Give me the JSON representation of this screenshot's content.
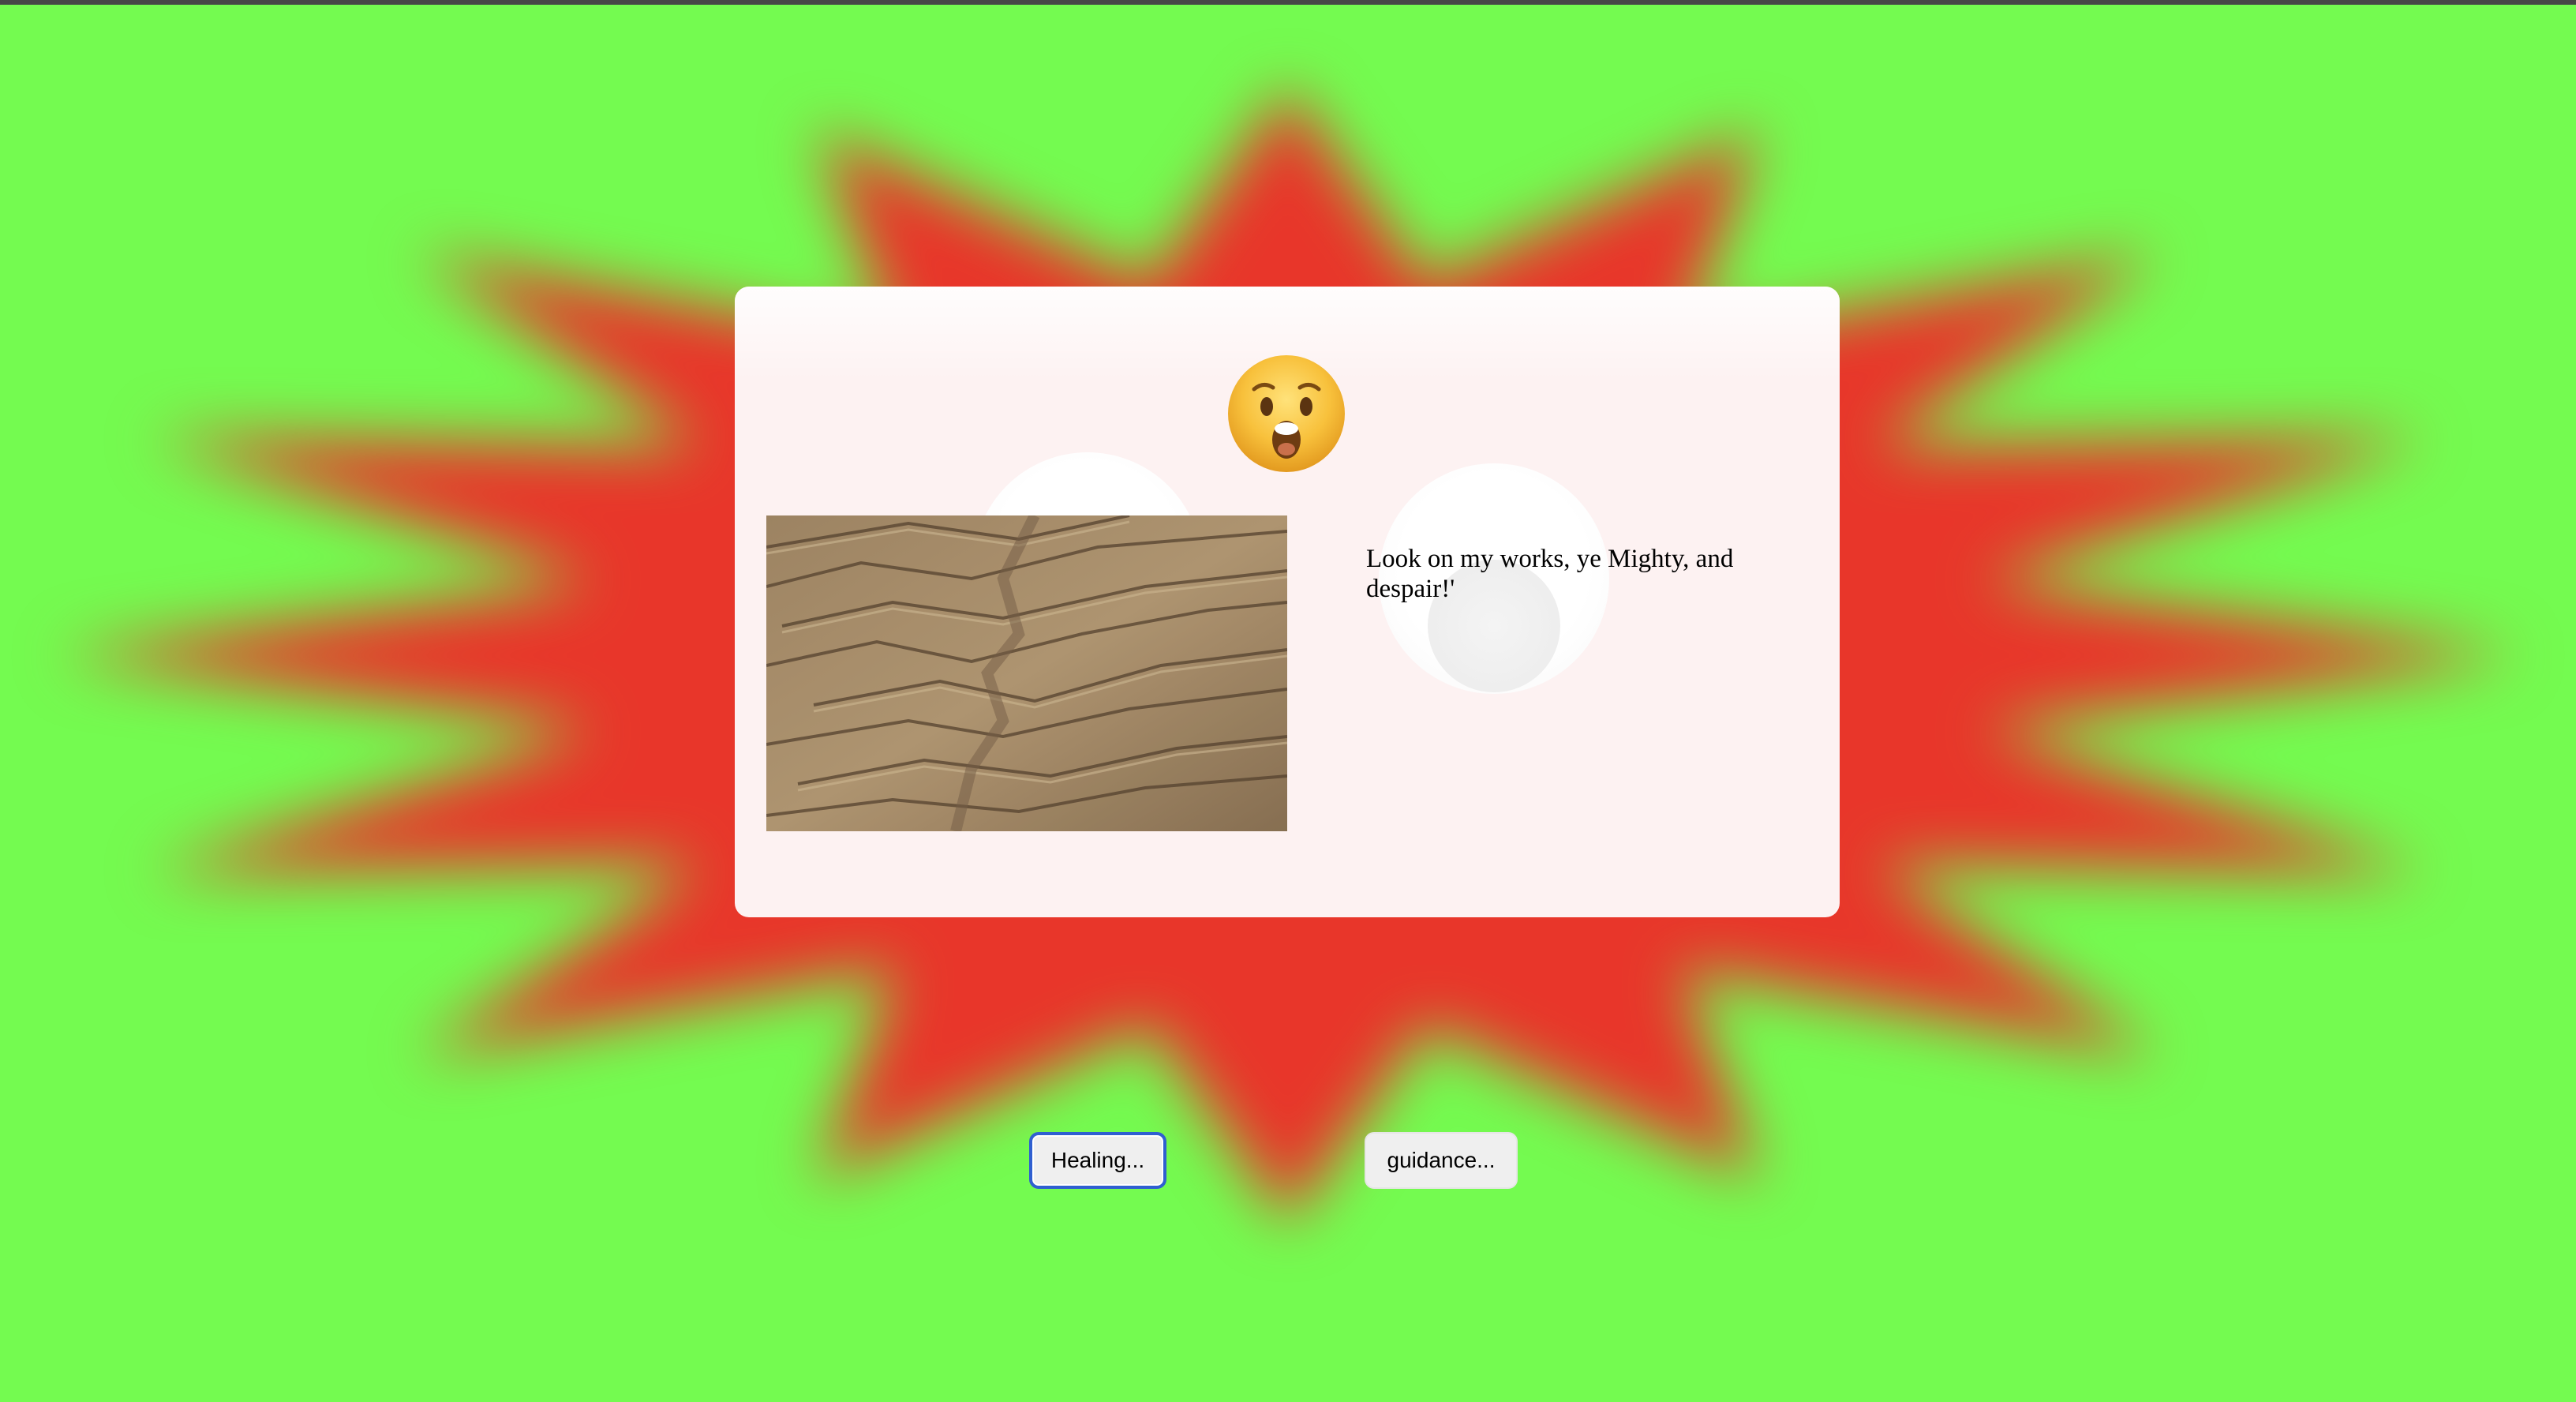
{
  "background": {
    "color": "#74fb50",
    "starburst_color": "#e8362a"
  },
  "card": {
    "emoji_icon": "astonished-face-icon",
    "quote": "Look on my works, ye Mighty, and despair!'"
  },
  "photo": {
    "description_icon": "layered-rock-terrain-photo"
  },
  "buttons": {
    "healing_label": "Healing...",
    "guidance_label": "guidance..."
  }
}
